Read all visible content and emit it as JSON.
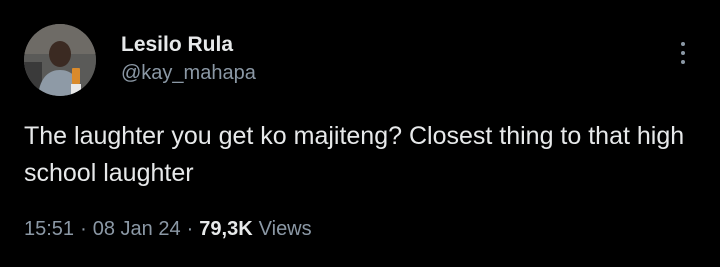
{
  "author": {
    "display_name": "Lesilo Rula",
    "handle": "@kay_mahapa"
  },
  "tweet": {
    "text": "The laughter you get ko majiteng? Closest thing to that high school laughter",
    "time": "15:51",
    "separator": "·",
    "date": "08 Jan 24",
    "views_count": "79,3K",
    "views_label": "Views"
  },
  "icons": {
    "more": "more-options-icon",
    "avatar": "profile-photo"
  },
  "colors": {
    "background": "#000000",
    "primary_text": "#e7e9ea",
    "secondary_text": "#8b98a5"
  }
}
